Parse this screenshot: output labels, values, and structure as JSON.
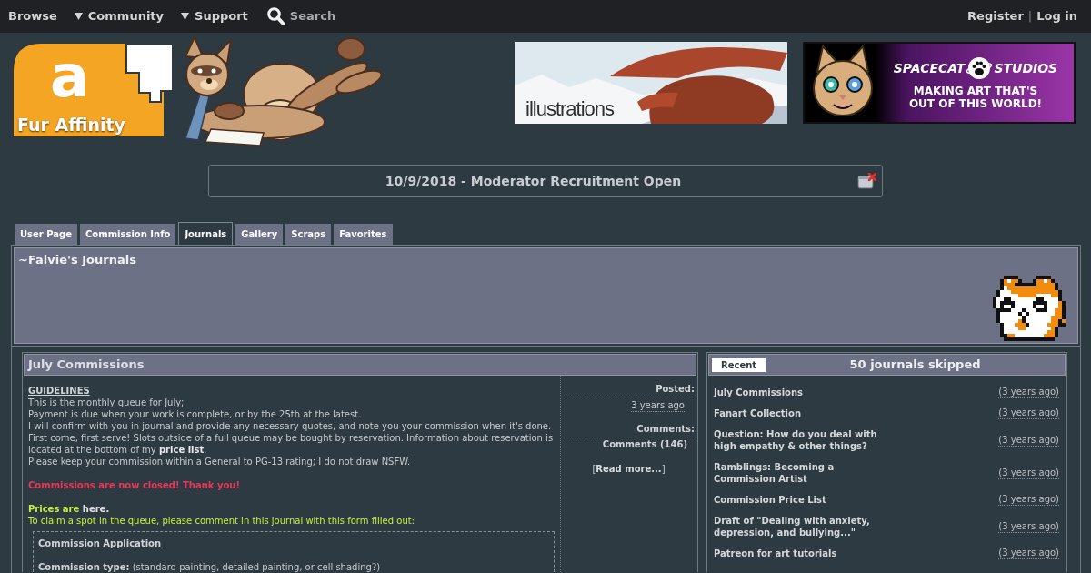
{
  "nav": {
    "links": [
      {
        "label": "Browse",
        "dropdown": false
      },
      {
        "label": "Community",
        "dropdown": true
      },
      {
        "label": "Support",
        "dropdown": true
      }
    ],
    "search": {
      "label": "Search"
    },
    "account": [
      {
        "label": "Register"
      },
      {
        "label": "Log in"
      }
    ],
    "separator": "|"
  },
  "header": {
    "logo": {
      "mark": "a",
      "name": "Fur Affinity"
    },
    "banners": [
      {
        "kind": "illustration",
        "text": "illustrations"
      },
      {
        "kind": "spacecat",
        "title": [
          "SPACECAT",
          "STUDIOS"
        ],
        "tagline": [
          "MAKING ART THAT'S",
          "OUT OF THIS WORLD!"
        ]
      }
    ]
  },
  "notice": {
    "text": "10/9/2018 - Moderator Recruitment Open"
  },
  "tabs": [
    {
      "label": "User Page",
      "selected": false
    },
    {
      "label": "Commission Info",
      "selected": false
    },
    {
      "label": "Journals",
      "selected": true
    },
    {
      "label": "Gallery",
      "selected": false
    },
    {
      "label": "Scraps",
      "selected": false
    },
    {
      "label": "Favorites",
      "selected": false
    }
  ],
  "profile_header": {
    "title": "~Falvie's Journals"
  },
  "journal": {
    "title": "July Commissions",
    "body": [
      {
        "kind": "heading",
        "text": "GUIDELINES"
      },
      {
        "kind": "text",
        "text": "This is the monthly queue for July;"
      },
      {
        "kind": "text",
        "text": "Payment is due when your work is complete, or by the 25th at the latest."
      },
      {
        "kind": "text",
        "text": "I will confirm with you in journal and provide any necessary quotes, and note you your commission when it's done."
      },
      {
        "kind": "text",
        "text": "First come, first serve! Slots outside of a full queue may be bought by reservation. Information about reservation is located at the bottom of my **price list**."
      },
      {
        "kind": "text",
        "text": "Please keep your commission within a General to PG-13 rating; I do not draw NSFW."
      },
      {
        "kind": "alert",
        "text": "Commissions are now closed! Thank you!"
      },
      {
        "kind": "prices",
        "text": "Prices are",
        "link": "here."
      },
      {
        "kind": "highlight",
        "text": "To claim a spot in the queue, please comment in this journal with this form filled out:"
      },
      {
        "kind": "form",
        "title": "Commission Application",
        "fields": [
          {
            "label": "Commission type:",
            "note": "(standard painting, detailed painting, or cell shading?)"
          }
        ]
      }
    ],
    "meta": {
      "posted_label": "Posted:",
      "posted": "3 years ago",
      "comments_label": "Comments:",
      "comments": "Comments (146)",
      "read_more": "[**Read more...**]"
    }
  },
  "sidebar": {
    "button": "Recent",
    "title": "50 journals skipped",
    "items": [
      {
        "title": "July Commissions",
        "time": "(3 years ago)"
      },
      {
        "title": "Fanart Collection",
        "time": "(3 years ago)"
      },
      {
        "title": "Question: How do you deal with high empathy & other things?",
        "time": "(3 years ago)"
      },
      {
        "title": "Ramblings: Becoming a Commission Artist",
        "time": "(3 years ago)"
      },
      {
        "title": "Commission Price List",
        "time": "(3 years ago)"
      },
      {
        "title": "Draft of \"Dealing with anxiety, depression, and bullying...\"",
        "time": "(3 years ago)"
      },
      {
        "title": "Patreon for art tutorials",
        "time": "(3 years ago)"
      }
    ]
  }
}
